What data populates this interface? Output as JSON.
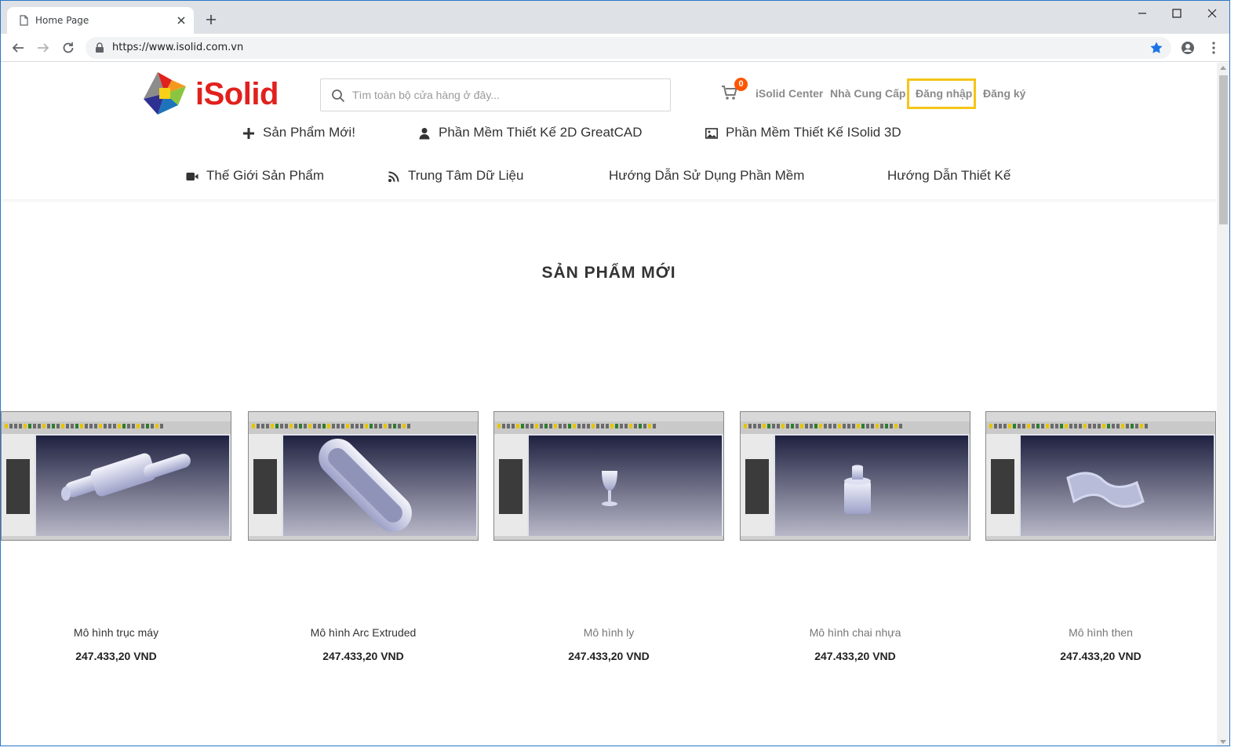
{
  "browser": {
    "tab_title": "Home Page",
    "url": "https://www.isolid.com.vn"
  },
  "header": {
    "brand": "iSolid",
    "search_placeholder": "Tìm toàn bộ cửa hàng ở đây...",
    "cart_count": "0",
    "links": {
      "center": "iSolid Center",
      "suppliers": "Nhà Cung Cấp",
      "login": "Đăng nhập",
      "register": "Đăng ký"
    },
    "colors": {
      "brand_red": "#e0211d",
      "badge": "#ff5501",
      "highlight": "#f5c518"
    }
  },
  "menu": {
    "row1": [
      {
        "label": "Sản Phẩm Mới!",
        "icon": "plus-icon"
      },
      {
        "label": "Phần Mềm Thiết Kế 2D GreatCAD",
        "icon": "user-icon"
      },
      {
        "label": "Phần Mềm Thiết Kế ISolid 3D",
        "icon": "image-icon"
      }
    ],
    "row2": [
      {
        "label": "Thế Giới Sản Phẩm",
        "icon": "video-icon"
      },
      {
        "label": "Trung Tâm Dữ Liệu",
        "icon": "rss-icon"
      },
      {
        "label": "Hướng Dẫn Sử Dụng Phần Mềm",
        "icon": ""
      },
      {
        "label": "Hướng Dẫn Thiết Kế",
        "icon": ""
      }
    ]
  },
  "section": {
    "title": "SẢN PHẨM MỚI"
  },
  "products": [
    {
      "name": "Mô hình trục máy",
      "price": "247.433,20 VND",
      "model": "shaft"
    },
    {
      "name": "Mô hình Arc Extruded",
      "price": "247.433,20 VND",
      "model": "arc"
    },
    {
      "name": "Mô hình ly",
      "price": "247.433,20 VND",
      "model": "glass"
    },
    {
      "name": "Mô hình chai nhựa",
      "price": "247.433,20 VND",
      "model": "bottle"
    },
    {
      "name": "Mô hình then",
      "price": "247.433,20 VND",
      "model": "key"
    }
  ]
}
